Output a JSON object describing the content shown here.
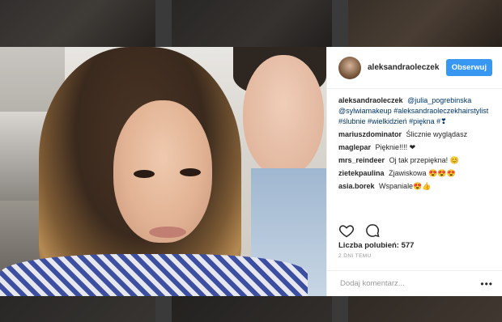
{
  "post": {
    "username": "aleksandraoleczek",
    "follow_label": "Obserwuj",
    "caption": {
      "user": "aleksandraoleczek",
      "mention1": "@julia_pogrebinska",
      "mention2": "@sylwiamakeup",
      "tag1": "#aleksandraoleczekhairstylist",
      "tag2": "#ślubnie",
      "tag3": "#wielkidzień",
      "tag4": "#piękna",
      "tag5": "#❣"
    },
    "comments": [
      {
        "user": "mariuszdominator",
        "text": "Ślicznie wyglądasz"
      },
      {
        "user": "maglepar",
        "text": "Pięknie!!!! ❤"
      },
      {
        "user": "mrs_reindeer",
        "text": "Oj tak przepiękna! 😊"
      },
      {
        "user": "zietekpaulina",
        "text": "Zjawiskowa 😍😍😍"
      },
      {
        "user": "asia.borek",
        "text": "Wspaniale😍👍"
      }
    ],
    "likes_label": "Liczba polubień: 577",
    "time": "2 DNI TEMU",
    "add_comment_placeholder": "Dodaj komentarz...",
    "more_label": "•••",
    "icons": [
      "heart-icon",
      "comment-icon"
    ]
  },
  "colors": {
    "accent": "#3897f0",
    "link": "#003569"
  }
}
